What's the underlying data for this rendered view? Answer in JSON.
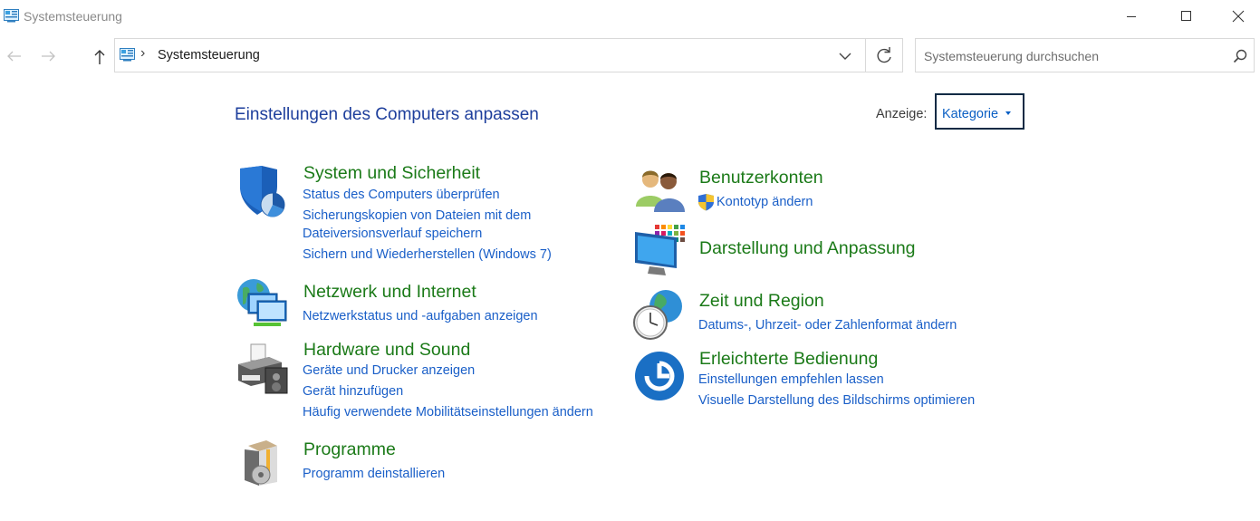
{
  "window": {
    "title": "Systemsteuerung",
    "controls": [
      "minimize-icon",
      "maximize-icon",
      "close-icon"
    ]
  },
  "address": {
    "path": "Systemsteuerung",
    "separator": "›",
    "search_placeholder": "Systemsteuerung durchsuchen"
  },
  "header": {
    "title": "Einstellungen des Computers anpassen",
    "view_label": "Anzeige:",
    "view_value": "Kategorie"
  },
  "categories": {
    "system": {
      "title": "System und Sicherheit",
      "icon": "shield-icon",
      "links": [
        "Status des Computers überprüfen",
        "Sicherungskopien von Dateien mit dem",
        "Dateiversionsverlauf speichern",
        "Sichern und Wiederherstellen (Windows 7)"
      ]
    },
    "network": {
      "title": "Netzwerk und Internet",
      "icon": "network-globe-icon",
      "links": [
        "Netzwerkstatus und -aufgaben anzeigen"
      ]
    },
    "hardware": {
      "title": "Hardware und Sound",
      "icon": "printer-icon",
      "links": [
        "Geräte und Drucker anzeigen",
        "Gerät hinzufügen",
        "Häufig verwendete Mobilitätseinstellungen ändern"
      ]
    },
    "programs": {
      "title": "Programme",
      "icon": "programs-box-icon",
      "links": [
        "Programm deinstallieren"
      ]
    },
    "users": {
      "title": "Benutzerkonten",
      "icon": "users-icon",
      "links": [
        "Kontotyp ändern"
      ]
    },
    "appearance": {
      "title": "Darstellung und Anpassung",
      "icon": "monitor-palette-icon",
      "links": []
    },
    "time": {
      "title": "Zeit und Region",
      "icon": "clock-globe-icon",
      "links": [
        "Datums-, Uhrzeit- oder Zahlenformat ändern"
      ]
    },
    "access": {
      "title": "Erleichterte Bedienung",
      "icon": "ease-of-access-icon",
      "links": [
        "Einstellungen empfehlen lassen",
        "Visuelle Darstellung des Bildschirms optimieren"
      ]
    }
  },
  "colors": {
    "category_title": "#1b7a18",
    "link": "#1a5fc8",
    "page_title": "#1e3f9c"
  }
}
